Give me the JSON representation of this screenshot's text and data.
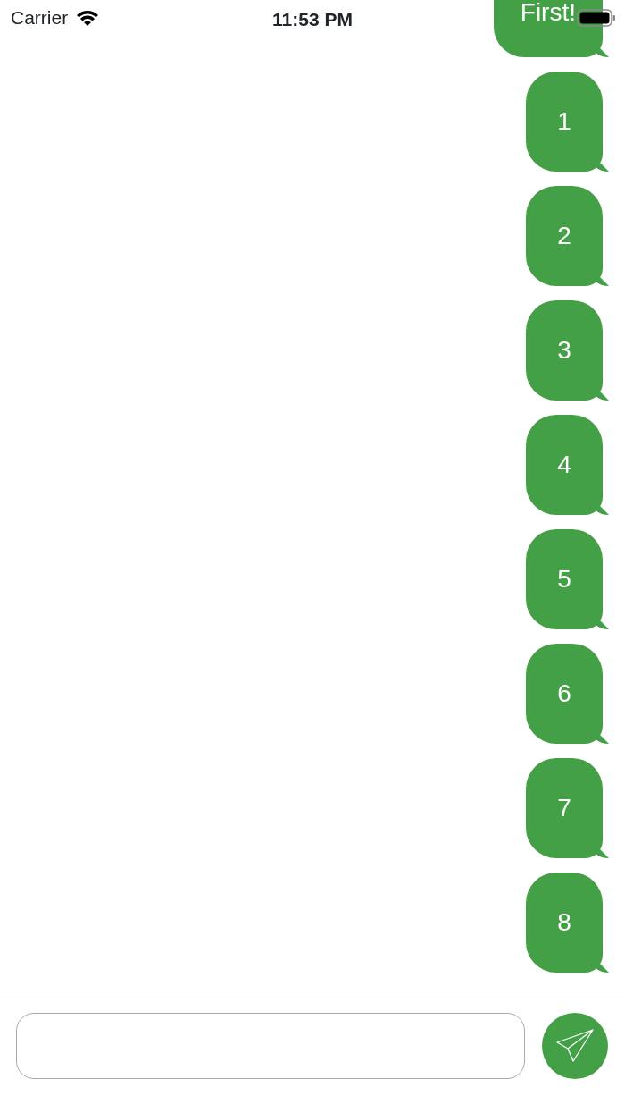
{
  "status_bar": {
    "carrier": "Carrier",
    "time": "11:53 PM"
  },
  "messages": [
    {
      "text": "First!"
    },
    {
      "text": "1"
    },
    {
      "text": "2"
    },
    {
      "text": "3"
    },
    {
      "text": "4"
    },
    {
      "text": "5"
    },
    {
      "text": "6"
    },
    {
      "text": "7"
    },
    {
      "text": "8"
    }
  ]
}
